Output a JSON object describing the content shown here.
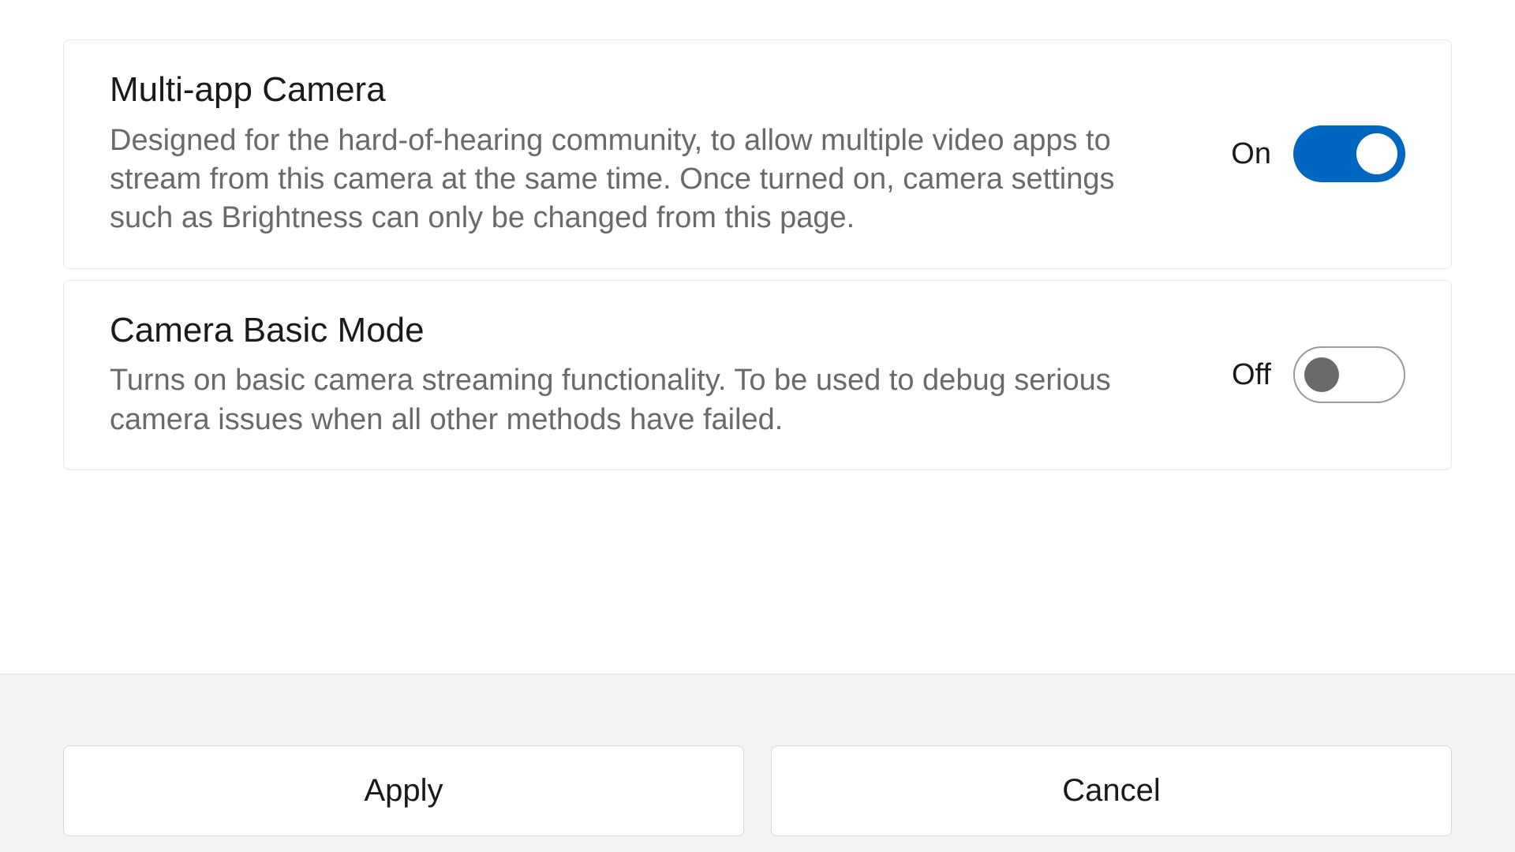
{
  "settings": [
    {
      "title": "Multi-app Camera",
      "description": "Designed for the hard-of-hearing community, to allow multiple video apps to stream from this camera at the same time. Once turned on, camera settings such as Brightness can only be changed from this page.",
      "state_label": "On",
      "state": "on"
    },
    {
      "title": "Camera Basic Mode",
      "description": "Turns on basic camera streaming functionality. To be used to debug serious camera issues when all other methods have failed.",
      "state_label": "Off",
      "state": "off"
    }
  ],
  "footer": {
    "apply_label": "Apply",
    "cancel_label": "Cancel"
  }
}
